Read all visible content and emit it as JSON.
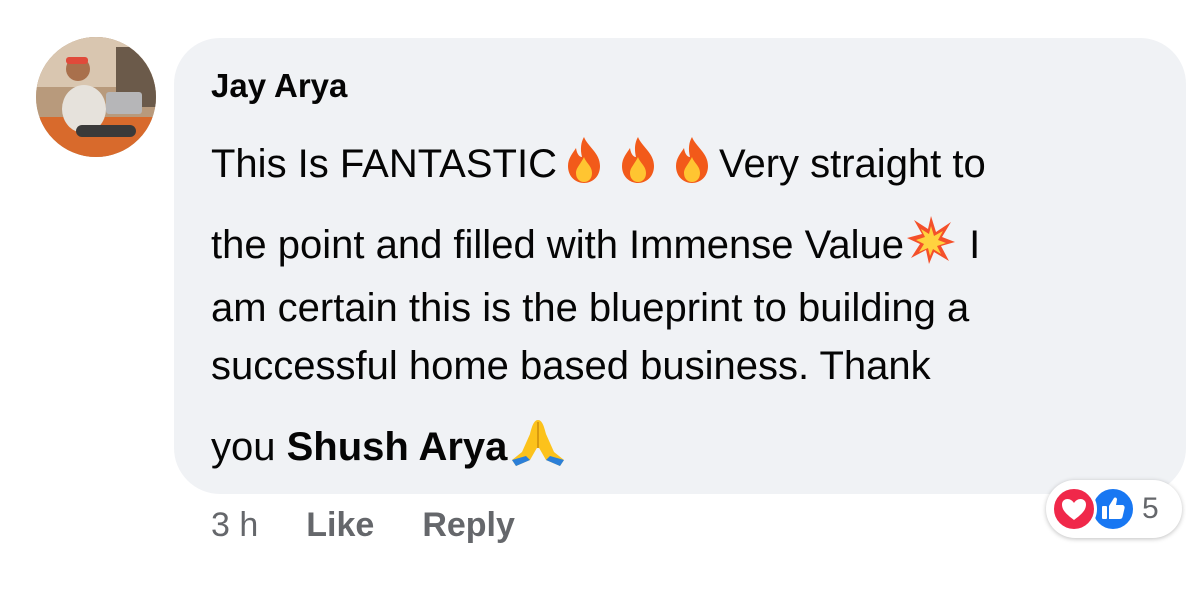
{
  "comment": {
    "author": "Jay Arya",
    "text_lines": [
      {
        "before": "This Is FANTASTIC",
        "after": "Very straight to"
      },
      {
        "before": "the point and filled with Immense Value",
        "after": " I"
      },
      {
        "text": "am certain this is the blueprint to building a"
      },
      {
        "text": "successful home based business. Thank"
      },
      {
        "before": "you ",
        "bold": "Shush Arya"
      }
    ],
    "emojis": [
      "fire-emoji",
      "fire-emoji",
      "fire-emoji",
      "collision-emoji",
      "folded-hands-emoji"
    ]
  },
  "actions": {
    "time": "3 h",
    "like_label": "Like",
    "reply_label": "Reply"
  },
  "reactions": {
    "icons": [
      "love-icon",
      "like-icon"
    ],
    "count": "5"
  },
  "colors": {
    "bubble_bg": "#f0f2f5",
    "text": "#050505",
    "secondary_text": "#65676b",
    "love": "#f0284a",
    "like": "#1877f2"
  }
}
